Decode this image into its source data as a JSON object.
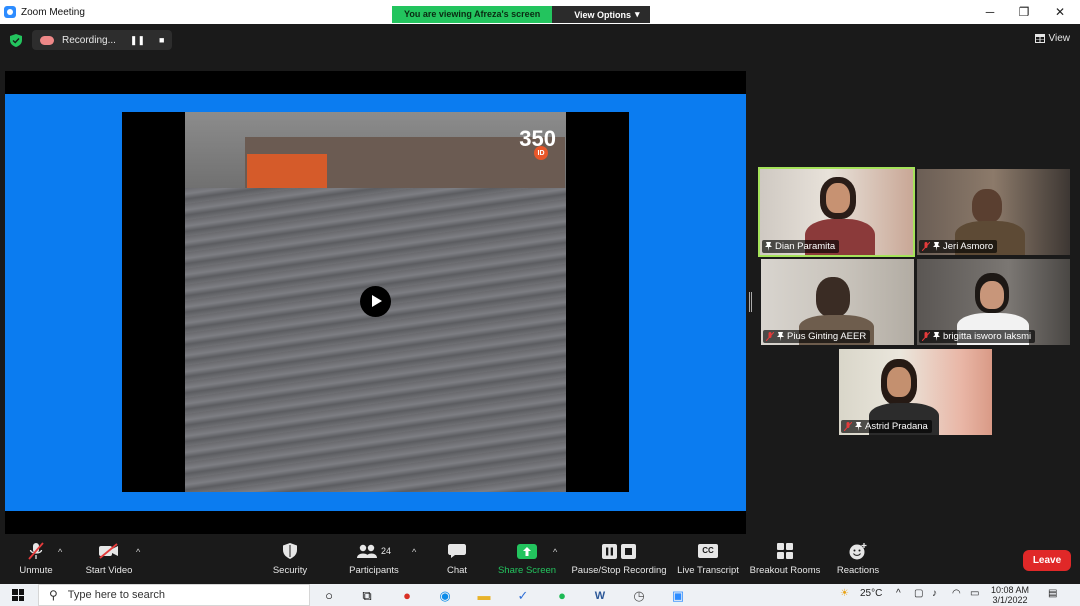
{
  "window": {
    "title": "Zoom Meeting",
    "minimize": "─",
    "restore": "❐",
    "close": "✕"
  },
  "banner": {
    "viewing_text": "You are viewing Afreza's screen",
    "view_options_label": "View Options",
    "view_options_caret": "▾"
  },
  "topbar": {
    "recording_label": "Recording...",
    "pause_glyph": "❚❚",
    "stop_glyph": "■",
    "view_label": "View",
    "security_color": "#23c45e"
  },
  "shared_video": {
    "watermark": "350",
    "watermark_badge": "ID"
  },
  "participants": [
    {
      "name": "Dian Paramita",
      "active": true
    },
    {
      "name": "Jeri Asmoro",
      "active": false
    },
    {
      "name": "Pius Ginting AEER",
      "active": false
    },
    {
      "name": "brigitta isworo laksmi",
      "active": false
    },
    {
      "name": "Astrid Pradana",
      "active": false
    }
  ],
  "toolbar": {
    "unmute": "Unmute",
    "start_video": "Start Video",
    "security": "Security",
    "participants": "Participants",
    "participants_count": "24",
    "chat": "Chat",
    "share_screen": "Share Screen",
    "pause_stop_recording": "Pause/Stop Recording",
    "live_transcript": "Live Transcript",
    "live_transcript_badge": "CC",
    "breakout_rooms": "Breakout Rooms",
    "reactions": "Reactions",
    "leave": "Leave",
    "caret": "^",
    "share_color": "#23c45e",
    "leave_color": "#e02828"
  },
  "taskbar": {
    "search_placeholder": "Type here to search",
    "temperature": "25°C",
    "time": "10:08 AM",
    "date": "3/1/2022"
  }
}
